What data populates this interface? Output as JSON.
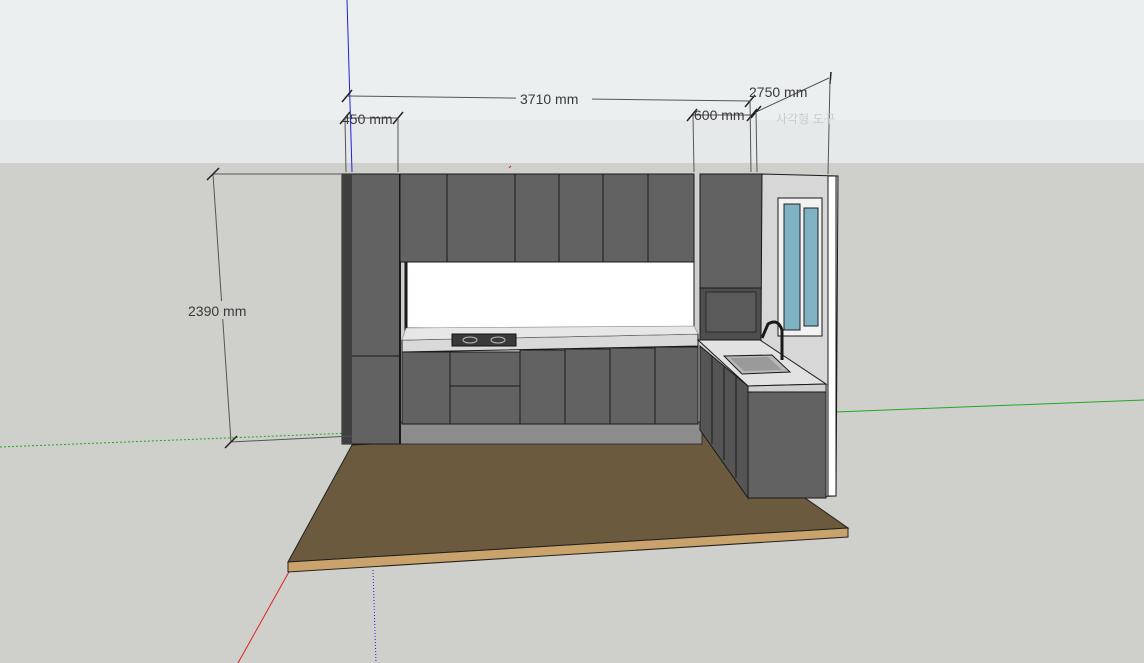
{
  "viewport": {
    "sky_color": "#eceff0",
    "ground_color": "#cfcfcb",
    "axis_colors": {
      "x_red": "#e02020",
      "y_green": "#1faa1f",
      "z_blue": "#2020e0"
    }
  },
  "dimensions": {
    "overall_width": "3710 mm",
    "left_tall_cabinet": "450 mm",
    "upper_cabinet_right": "600 mm",
    "side_return": "2750 mm",
    "height": "2390 mm"
  },
  "faint_label": "사각형 도구",
  "model": {
    "floor_color": "#6b5a3e",
    "floor_edge_color": "#c9a36b",
    "cabinet_color": "#626262",
    "cabinet_dark": "#3f3f3f",
    "countertop_color": "#d9d9d9",
    "wall_color": "#d7d7d7",
    "window_glass": "#7fb3c4",
    "backsplash_color": "#ffffff"
  }
}
